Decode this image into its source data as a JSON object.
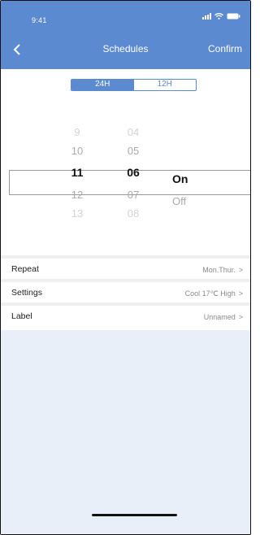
{
  "status_bar": {
    "time": "9:41",
    "icons": [
      "signal-icon",
      "wifi-icon",
      "battery-icon"
    ]
  },
  "nav": {
    "back_icon": "chevron-left-icon",
    "title": "Schedules",
    "confirm_label": "Confirm"
  },
  "time_format": {
    "options": [
      "24H",
      "12H"
    ],
    "selected": "24H"
  },
  "picker": {
    "hours": [
      "9",
      "10",
      "11",
      "12",
      "13"
    ],
    "minutes": [
      "04",
      "05",
      "06",
      "07",
      "08"
    ],
    "states": [
      "On",
      "Off"
    ],
    "selected": {
      "hour": "11",
      "minute": "06",
      "state": "On"
    }
  },
  "settings": [
    {
      "label": "Repeat",
      "value": "Mon.Thur."
    },
    {
      "label": "Settings",
      "value": "Cool 17℃ High"
    },
    {
      "label": "Label",
      "value": "Unnamed"
    }
  ],
  "colors": {
    "accent": "#5b8ad0",
    "panel": "#e8eff8"
  }
}
